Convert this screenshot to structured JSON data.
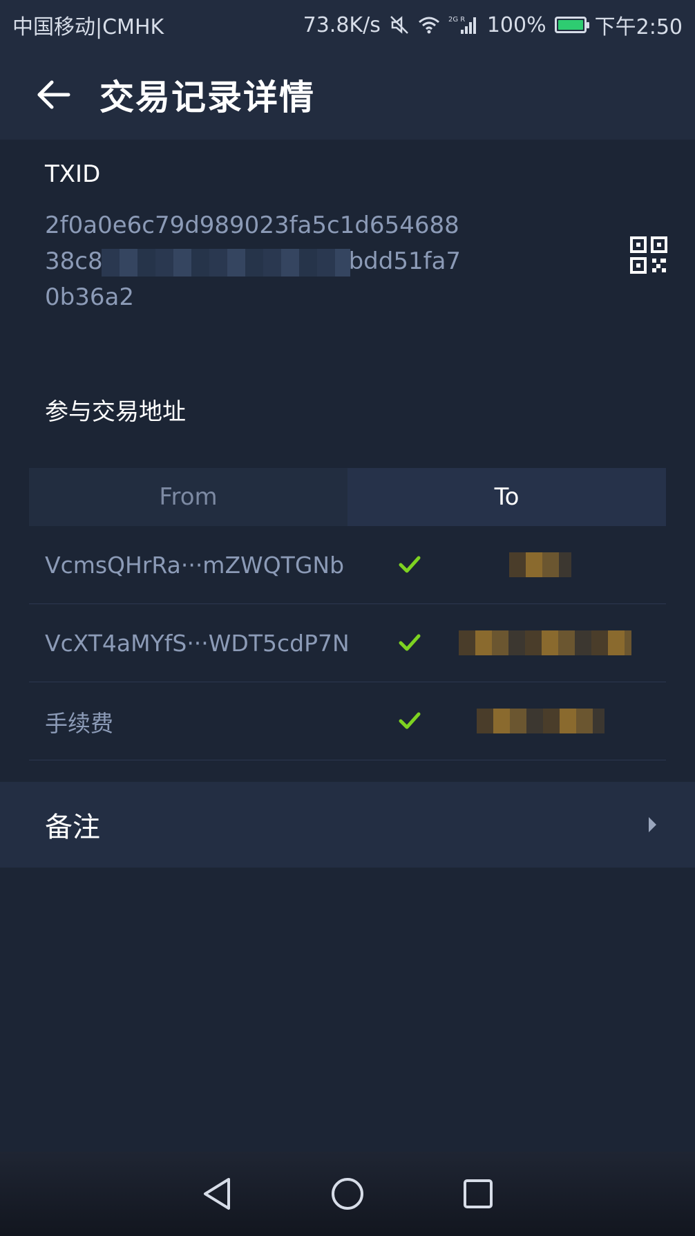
{
  "status_bar": {
    "carrier": "中国移动|CMHK",
    "network_speed": "73.8K/s",
    "signal_label": "2G R",
    "battery_percent": "100%",
    "battery_level": 1.0,
    "time": "下午2:50",
    "battery_color": "#2ecc71"
  },
  "header": {
    "title": "交易记录详情",
    "back_icon": "arrow-left-icon"
  },
  "txid": {
    "label": "TXID",
    "line1": "2f0a0e6c79d989023fa5c1d654688",
    "line2_start": "38c8",
    "line2_end": "bdd51fa7",
    "line3": "0b36a2",
    "qr_icon": "qr-code-icon"
  },
  "participants": {
    "title": "参与交易地址",
    "tabs": [
      {
        "label": "From",
        "selected": false
      },
      {
        "label": "To",
        "selected": true
      }
    ],
    "rows": [
      {
        "address": "VcmsQHrRa···mZWQTGNb",
        "checked": true
      },
      {
        "address": "VcXT4aMYfS···WDT5cdP7N",
        "checked": true
      },
      {
        "address": "手续费",
        "checked": true
      }
    ]
  },
  "notes": {
    "label": "备注"
  },
  "colors": {
    "background": "#1c2535",
    "header": "#222c3f",
    "accent_check": "#7ed321",
    "muted_text": "#8c9bb7"
  }
}
